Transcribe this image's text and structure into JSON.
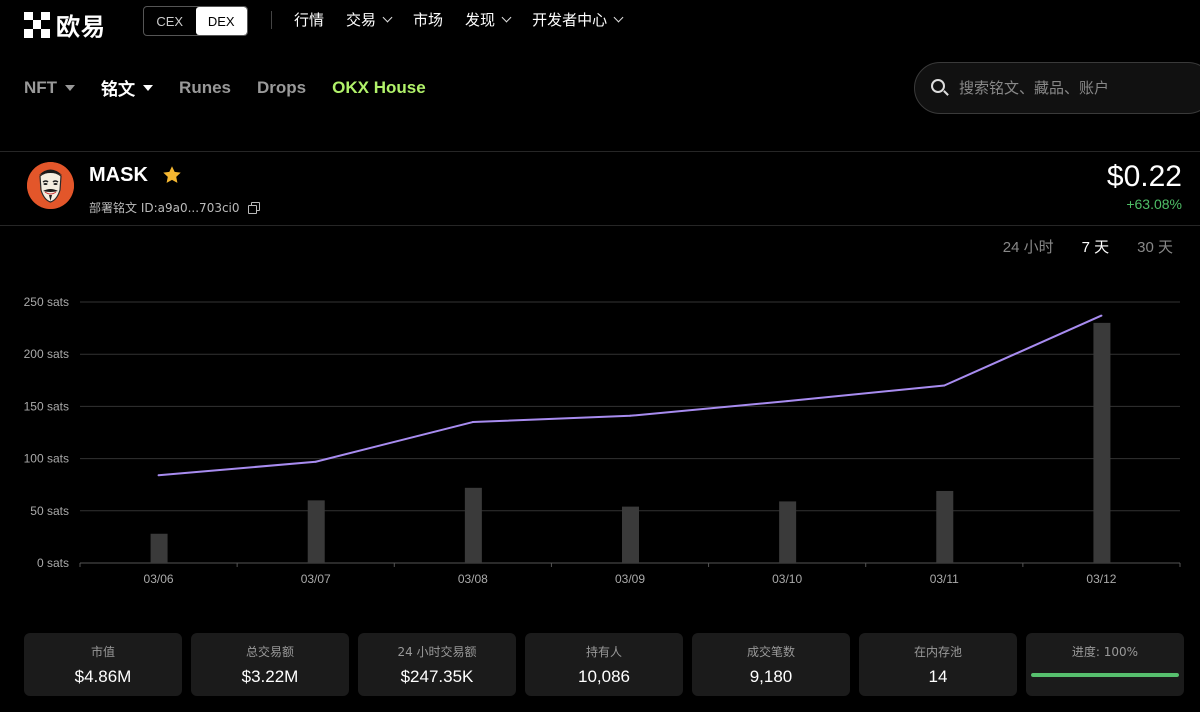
{
  "logo": {
    "text": "欧易"
  },
  "env_toggle": {
    "options": [
      "CEX",
      "DEX"
    ],
    "active": "DEX"
  },
  "main_menu": [
    {
      "label": "行情",
      "dropdown": false
    },
    {
      "label": "交易",
      "dropdown": true
    },
    {
      "label": "市场",
      "dropdown": false
    },
    {
      "label": "发现",
      "dropdown": true
    },
    {
      "label": "开发者中心",
      "dropdown": true
    }
  ],
  "sub_nav": [
    {
      "label": "NFT",
      "dropdown": true,
      "style": "muted"
    },
    {
      "label": "铭文",
      "dropdown": true,
      "style": "active"
    },
    {
      "label": "Runes",
      "dropdown": false,
      "style": "muted"
    },
    {
      "label": "Drops",
      "dropdown": false,
      "style": "muted"
    },
    {
      "label": "OKX House",
      "dropdown": false,
      "style": "accent"
    }
  ],
  "search": {
    "placeholder": "搜索铭文、藏品、账户"
  },
  "token": {
    "name": "MASK",
    "deploy_label": "部署铭文 ID:a9a0...703ci0",
    "price": "$0.22",
    "change": "+63.08%"
  },
  "periods": [
    {
      "label": "24 小时",
      "active": false
    },
    {
      "label": "7 天",
      "active": true
    },
    {
      "label": "30 天",
      "active": false
    }
  ],
  "chart_data": {
    "type": "line",
    "categories": [
      "03/06",
      "03/07",
      "03/08",
      "03/09",
      "03/10",
      "03/11",
      "03/12"
    ],
    "series": [
      {
        "type": "line",
        "values": [
          84,
          97,
          135,
          141,
          155,
          170,
          237
        ],
        "color": "#a88cf0"
      },
      {
        "type": "bar",
        "values": [
          28,
          60,
          72,
          54,
          59,
          69,
          230
        ],
        "color": "#3a3a3a"
      }
    ],
    "ylim": [
      0,
      250
    ],
    "yticks": [
      0,
      50,
      100,
      150,
      200,
      250
    ],
    "ytick_labels": [
      "0 sats",
      "50 sats",
      "100 sats",
      "150 sats",
      "200 sats",
      "250 sats"
    ],
    "grid": true
  },
  "stats": [
    {
      "label": "市值",
      "value": "$4.86M"
    },
    {
      "label": "总交易额",
      "value": "$3.22M"
    },
    {
      "label": "24 小时交易额",
      "value": "$247.35K"
    },
    {
      "label": "持有人",
      "value": "10,086"
    },
    {
      "label": "成交笔数",
      "value": "9,180"
    },
    {
      "label": "在内存池",
      "value": "14"
    }
  ],
  "progress": {
    "label": "进度: 100%",
    "fraction": 1.0,
    "color": "#57c06e"
  },
  "colors": {
    "accent": "#b1f26a",
    "positive": "#4fbf67",
    "line": "#a88cf0"
  },
  "icons": {
    "star": "star-icon",
    "copy": "copy-icon",
    "search": "search-icon",
    "avatar": "guy-fawkes-mask-icon"
  }
}
